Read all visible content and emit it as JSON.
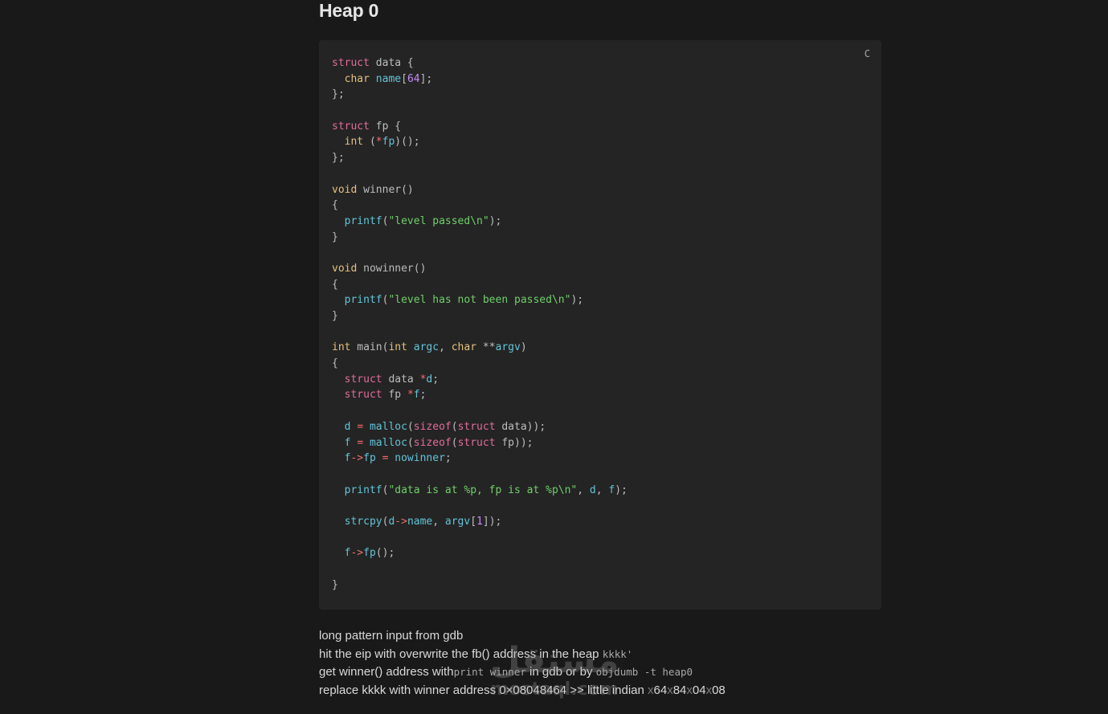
{
  "page": {
    "title": "Heap 0",
    "copy_button_label": "C"
  },
  "code_lines": [
    [
      [
        "kw",
        "struct"
      ],
      [
        "pl",
        " data {"
      ]
    ],
    [
      [
        "pl",
        "  "
      ],
      [
        "ty",
        "char"
      ],
      [
        "pl",
        " "
      ],
      [
        "fn",
        "name"
      ],
      [
        "pl",
        "["
      ],
      [
        "num",
        "64"
      ],
      [
        "pl",
        "];"
      ]
    ],
    [
      [
        "pl",
        "};"
      ]
    ],
    [],
    [
      [
        "kw",
        "struct"
      ],
      [
        "pl",
        " fp {"
      ]
    ],
    [
      [
        "pl",
        "  "
      ],
      [
        "ty",
        "int"
      ],
      [
        "pl",
        " ("
      ],
      [
        "op",
        "*"
      ],
      [
        "fn",
        "fp"
      ],
      [
        "pl",
        ")();"
      ]
    ],
    [
      [
        "pl",
        "};"
      ]
    ],
    [],
    [
      [
        "ty",
        "void"
      ],
      [
        "pl",
        " winner()"
      ]
    ],
    [
      [
        "pl",
        "{"
      ]
    ],
    [
      [
        "pl",
        "  "
      ],
      [
        "fn",
        "printf"
      ],
      [
        "pl",
        "("
      ],
      [
        "str",
        "\"level passed\\n\""
      ],
      [
        "pl",
        ");"
      ]
    ],
    [
      [
        "pl",
        "}"
      ]
    ],
    [],
    [
      [
        "ty",
        "void"
      ],
      [
        "pl",
        " nowinner()"
      ]
    ],
    [
      [
        "pl",
        "{"
      ]
    ],
    [
      [
        "pl",
        "  "
      ],
      [
        "fn",
        "printf"
      ],
      [
        "pl",
        "("
      ],
      [
        "str",
        "\"level has not been passed\\n\""
      ],
      [
        "pl",
        ");"
      ]
    ],
    [
      [
        "pl",
        "}"
      ]
    ],
    [],
    [
      [
        "ty",
        "int"
      ],
      [
        "pl",
        " main("
      ],
      [
        "ty",
        "int"
      ],
      [
        "pl",
        " "
      ],
      [
        "fn",
        "argc"
      ],
      [
        "pl",
        ", "
      ],
      [
        "ty",
        "char"
      ],
      [
        "pl",
        " **"
      ],
      [
        "fn",
        "argv"
      ],
      [
        "pl",
        ")"
      ]
    ],
    [
      [
        "pl",
        "{"
      ]
    ],
    [
      [
        "pl",
        "  "
      ],
      [
        "kw",
        "struct"
      ],
      [
        "pl",
        " data "
      ],
      [
        "op",
        "*"
      ],
      [
        "fn",
        "d"
      ],
      [
        "pl",
        ";"
      ]
    ],
    [
      [
        "pl",
        "  "
      ],
      [
        "kw",
        "struct"
      ],
      [
        "pl",
        " fp "
      ],
      [
        "op",
        "*"
      ],
      [
        "fn",
        "f"
      ],
      [
        "pl",
        ";"
      ]
    ],
    [],
    [
      [
        "pl",
        "  "
      ],
      [
        "fn",
        "d"
      ],
      [
        "pl",
        " "
      ],
      [
        "op",
        "="
      ],
      [
        "pl",
        " "
      ],
      [
        "fn",
        "malloc"
      ],
      [
        "pl",
        "("
      ],
      [
        "kw",
        "sizeof"
      ],
      [
        "pl",
        "("
      ],
      [
        "kw",
        "struct"
      ],
      [
        "pl",
        " data));"
      ]
    ],
    [
      [
        "pl",
        "  "
      ],
      [
        "fn",
        "f"
      ],
      [
        "pl",
        " "
      ],
      [
        "op",
        "="
      ],
      [
        "pl",
        " "
      ],
      [
        "fn",
        "malloc"
      ],
      [
        "pl",
        "("
      ],
      [
        "kw",
        "sizeof"
      ],
      [
        "pl",
        "("
      ],
      [
        "kw",
        "struct"
      ],
      [
        "pl",
        " fp));"
      ]
    ],
    [
      [
        "pl",
        "  "
      ],
      [
        "fn",
        "f"
      ],
      [
        "op",
        "->"
      ],
      [
        "fn",
        "fp"
      ],
      [
        "pl",
        " "
      ],
      [
        "op",
        "="
      ],
      [
        "pl",
        " "
      ],
      [
        "fn",
        "nowinner"
      ],
      [
        "pl",
        ";"
      ]
    ],
    [],
    [
      [
        "pl",
        "  "
      ],
      [
        "fn",
        "printf"
      ],
      [
        "pl",
        "("
      ],
      [
        "str",
        "\"data is at %p, fp is at %p\\n\""
      ],
      [
        "pl",
        ", "
      ],
      [
        "fn",
        "d"
      ],
      [
        "pl",
        ", "
      ],
      [
        "fn",
        "f"
      ],
      [
        "pl",
        ");"
      ]
    ],
    [],
    [
      [
        "pl",
        "  "
      ],
      [
        "fn",
        "strcpy"
      ],
      [
        "pl",
        "("
      ],
      [
        "fn",
        "d"
      ],
      [
        "op",
        "->"
      ],
      [
        "fn",
        "name"
      ],
      [
        "pl",
        ", "
      ],
      [
        "fn",
        "argv"
      ],
      [
        "pl",
        "["
      ],
      [
        "num",
        "1"
      ],
      [
        "pl",
        "]);"
      ]
    ],
    [],
    [
      [
        "pl",
        "  "
      ],
      [
        "fn",
        "f"
      ],
      [
        "op",
        "->"
      ],
      [
        "fn",
        "fp"
      ],
      [
        "pl",
        "();"
      ]
    ],
    [],
    [
      [
        "pl",
        "}"
      ]
    ]
  ],
  "notes": {
    "line1": "long pattern input from gdb",
    "line2_text": "hit the eip with overwrite the fb() address in the heap ",
    "line2_code": "kkkk'",
    "line3_text": "get winner() address with",
    "line3_code1": "print winner",
    "line3_mid": " in gdb or by ",
    "line3_code2": "objdumb -t heap0",
    "line4_text": "replace kkkk with winner address 0×08048464 >> little indian ",
    "line4_bytes": [
      [
        "x",
        "64"
      ],
      [
        "x",
        "84"
      ],
      [
        "x",
        "04"
      ],
      [
        "x",
        "08"
      ]
    ]
  },
  "watermark": {
    "arabic": "مستقل",
    "latin": "mostaql.com"
  },
  "colors": {
    "background": "#191919",
    "code_background": "#242424",
    "keyword": "#e06c9a",
    "type": "#e4c07a",
    "identifier": "#61c4d8",
    "string": "#6fcf6a",
    "number": "#c58af9",
    "operator": "#f46c6c"
  }
}
